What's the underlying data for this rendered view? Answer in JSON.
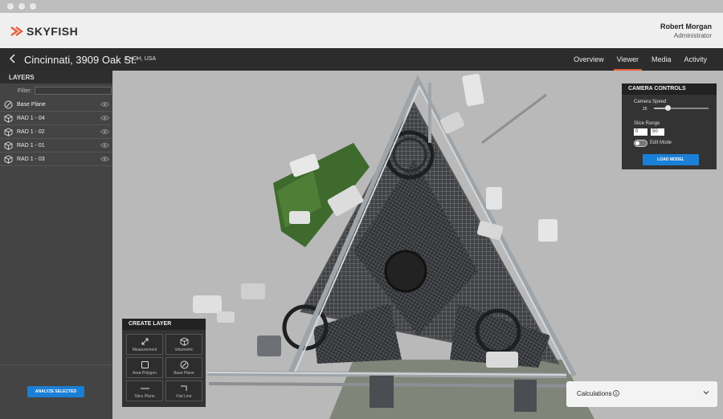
{
  "header": {
    "brand": "SKYFISH",
    "user_name": "Robert Morgan",
    "user_role": "Administrator"
  },
  "nav": {
    "title": "Cincinnati, 3909 Oak St.",
    "subtitle": "2 • OH, USA",
    "tabs": [
      {
        "label": "Overview",
        "active": false
      },
      {
        "label": "Viewer",
        "active": true
      },
      {
        "label": "Media",
        "active": false
      },
      {
        "label": "Activity",
        "active": false
      }
    ]
  },
  "sidebar": {
    "header": "LAYERS",
    "filter_label": "Filter:",
    "filter_value": "",
    "items": [
      {
        "label": "Base Plane",
        "icon": "base-plane-icon"
      },
      {
        "label": "RAD 1 - 04",
        "icon": "cube-icon"
      },
      {
        "label": "RAD 1 - 02",
        "icon": "cube-icon"
      },
      {
        "label": "RAD 1 - 01",
        "icon": "cube-icon"
      },
      {
        "label": "RAD 1 - 03",
        "icon": "cube-icon"
      }
    ],
    "analyze_label": "ANALYZE SELECTED"
  },
  "camera": {
    "header": "CAMERA CONTROLS",
    "speed_label": "Camera Speed",
    "speed_value": "25",
    "speed_fraction": 0.25,
    "range_label": "Slice Range",
    "range_min": "0",
    "range_max": "50",
    "edit_mode_label": "Edit Mode",
    "edit_mode_on": false,
    "load_label": "LOAD MODEL"
  },
  "create_layer": {
    "header": "CREATE LAYER",
    "tools": [
      {
        "label": "Measurement",
        "icon": "measurement-icon"
      },
      {
        "label": "Volumetric",
        "icon": "cube-icon"
      },
      {
        "label": "Area Polygon",
        "icon": "square-icon"
      },
      {
        "label": "Base Plane",
        "icon": "base-plane-icon"
      },
      {
        "label": "Slice Plane",
        "icon": "line-icon"
      },
      {
        "label": "Flat Line",
        "icon": "corner-line-icon"
      }
    ]
  },
  "calculations": {
    "label": "Calculations"
  },
  "colors": {
    "accent": "#e8603c",
    "primary_button": "#1a7fd6",
    "nav_bg": "#2c2c2c",
    "sidebar_bg": "#444444"
  }
}
